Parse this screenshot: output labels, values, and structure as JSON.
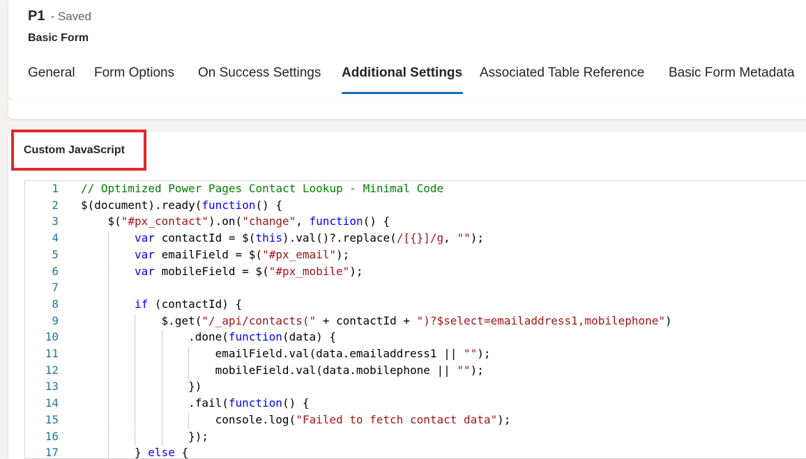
{
  "header": {
    "title": "P1",
    "status": "- Saved",
    "subtitle": "Basic Form",
    "tabs": [
      {
        "label": "General",
        "active": false
      },
      {
        "label": "Form Options",
        "active": false
      },
      {
        "label": "On Success Settings",
        "active": false
      },
      {
        "label": "Additional Settings",
        "active": true
      },
      {
        "label": "Associated Table Reference",
        "active": false
      },
      {
        "label": "Basic Form Metadata",
        "active": false
      }
    ]
  },
  "section": {
    "label": "Custom JavaScript"
  },
  "colors": {
    "accent": "#0f6cbd",
    "highlight_box": "#e3262b",
    "comment": "#008000",
    "keyword": "#0000ff",
    "string": "#a31515",
    "line_number": "#237893"
  },
  "editor": {
    "lines": [
      {
        "num": "1",
        "indent": 0,
        "tokens": [
          {
            "t": "// Optimized Power Pages Contact Lookup - Minimal Code",
            "c": "comment"
          }
        ]
      },
      {
        "num": "2",
        "indent": 0,
        "tokens": [
          {
            "t": "$(document).ready(",
            "c": "plain"
          },
          {
            "t": "function",
            "c": "keyword"
          },
          {
            "t": "() {",
            "c": "plain"
          }
        ]
      },
      {
        "num": "3",
        "indent": 1,
        "tokens": [
          {
            "t": "$(",
            "c": "plain"
          },
          {
            "t": "\"#px_contact\"",
            "c": "string"
          },
          {
            "t": ").on(",
            "c": "plain"
          },
          {
            "t": "\"change\"",
            "c": "string"
          },
          {
            "t": ", ",
            "c": "plain"
          },
          {
            "t": "function",
            "c": "keyword"
          },
          {
            "t": "() {",
            "c": "plain"
          }
        ]
      },
      {
        "num": "4",
        "indent": 2,
        "tokens": [
          {
            "t": "var",
            "c": "keyword"
          },
          {
            "t": " contactId = $(",
            "c": "plain"
          },
          {
            "t": "this",
            "c": "keyword"
          },
          {
            "t": ").val()?.replace(",
            "c": "plain"
          },
          {
            "t": "/[{}]/g",
            "c": "string"
          },
          {
            "t": ", ",
            "c": "plain"
          },
          {
            "t": "\"\"",
            "c": "string"
          },
          {
            "t": ");",
            "c": "plain"
          }
        ]
      },
      {
        "num": "5",
        "indent": 2,
        "tokens": [
          {
            "t": "var",
            "c": "keyword"
          },
          {
            "t": " emailField = $(",
            "c": "plain"
          },
          {
            "t": "\"#px_email\"",
            "c": "string"
          },
          {
            "t": ");",
            "c": "plain"
          }
        ]
      },
      {
        "num": "6",
        "indent": 2,
        "tokens": [
          {
            "t": "var",
            "c": "keyword"
          },
          {
            "t": " mobileField = $(",
            "c": "plain"
          },
          {
            "t": "\"#px_mobile\"",
            "c": "string"
          },
          {
            "t": ");",
            "c": "plain"
          }
        ]
      },
      {
        "num": "7",
        "indent": 2,
        "tokens": []
      },
      {
        "num": "8",
        "indent": 2,
        "tokens": [
          {
            "t": "if",
            "c": "keyword"
          },
          {
            "t": " (contactId) {",
            "c": "plain"
          }
        ]
      },
      {
        "num": "9",
        "indent": 3,
        "tokens": [
          {
            "t": "$.get(",
            "c": "plain"
          },
          {
            "t": "\"/_api/contacts(\"",
            "c": "string"
          },
          {
            "t": " + contactId + ",
            "c": "plain"
          },
          {
            "t": "\")?$select=emailaddress1,mobilephone\"",
            "c": "string"
          },
          {
            "t": ")",
            "c": "plain"
          }
        ]
      },
      {
        "num": "10",
        "indent": 4,
        "tokens": [
          {
            "t": ".done(",
            "c": "plain"
          },
          {
            "t": "function",
            "c": "keyword"
          },
          {
            "t": "(data) {",
            "c": "plain"
          }
        ]
      },
      {
        "num": "11",
        "indent": 5,
        "tokens": [
          {
            "t": "emailField.val(data.emailaddress1 || ",
            "c": "plain"
          },
          {
            "t": "\"\"",
            "c": "string"
          },
          {
            "t": ");",
            "c": "plain"
          }
        ]
      },
      {
        "num": "12",
        "indent": 5,
        "tokens": [
          {
            "t": "mobileField.val(data.mobilephone || ",
            "c": "plain"
          },
          {
            "t": "\"\"",
            "c": "string"
          },
          {
            "t": ");",
            "c": "plain"
          }
        ]
      },
      {
        "num": "13",
        "indent": 4,
        "tokens": [
          {
            "t": "})",
            "c": "plain"
          }
        ]
      },
      {
        "num": "14",
        "indent": 4,
        "tokens": [
          {
            "t": ".fail(",
            "c": "plain"
          },
          {
            "t": "function",
            "c": "keyword"
          },
          {
            "t": "() {",
            "c": "plain"
          }
        ]
      },
      {
        "num": "15",
        "indent": 5,
        "tokens": [
          {
            "t": "console.log(",
            "c": "plain"
          },
          {
            "t": "\"Failed to fetch contact data\"",
            "c": "string"
          },
          {
            "t": ");",
            "c": "plain"
          }
        ]
      },
      {
        "num": "16",
        "indent": 4,
        "tokens": [
          {
            "t": "});",
            "c": "plain"
          }
        ]
      },
      {
        "num": "17",
        "indent": 2,
        "tokens": [
          {
            "t": "} ",
            "c": "plain"
          },
          {
            "t": "else",
            "c": "keyword"
          },
          {
            "t": " {",
            "c": "plain"
          }
        ]
      }
    ]
  }
}
